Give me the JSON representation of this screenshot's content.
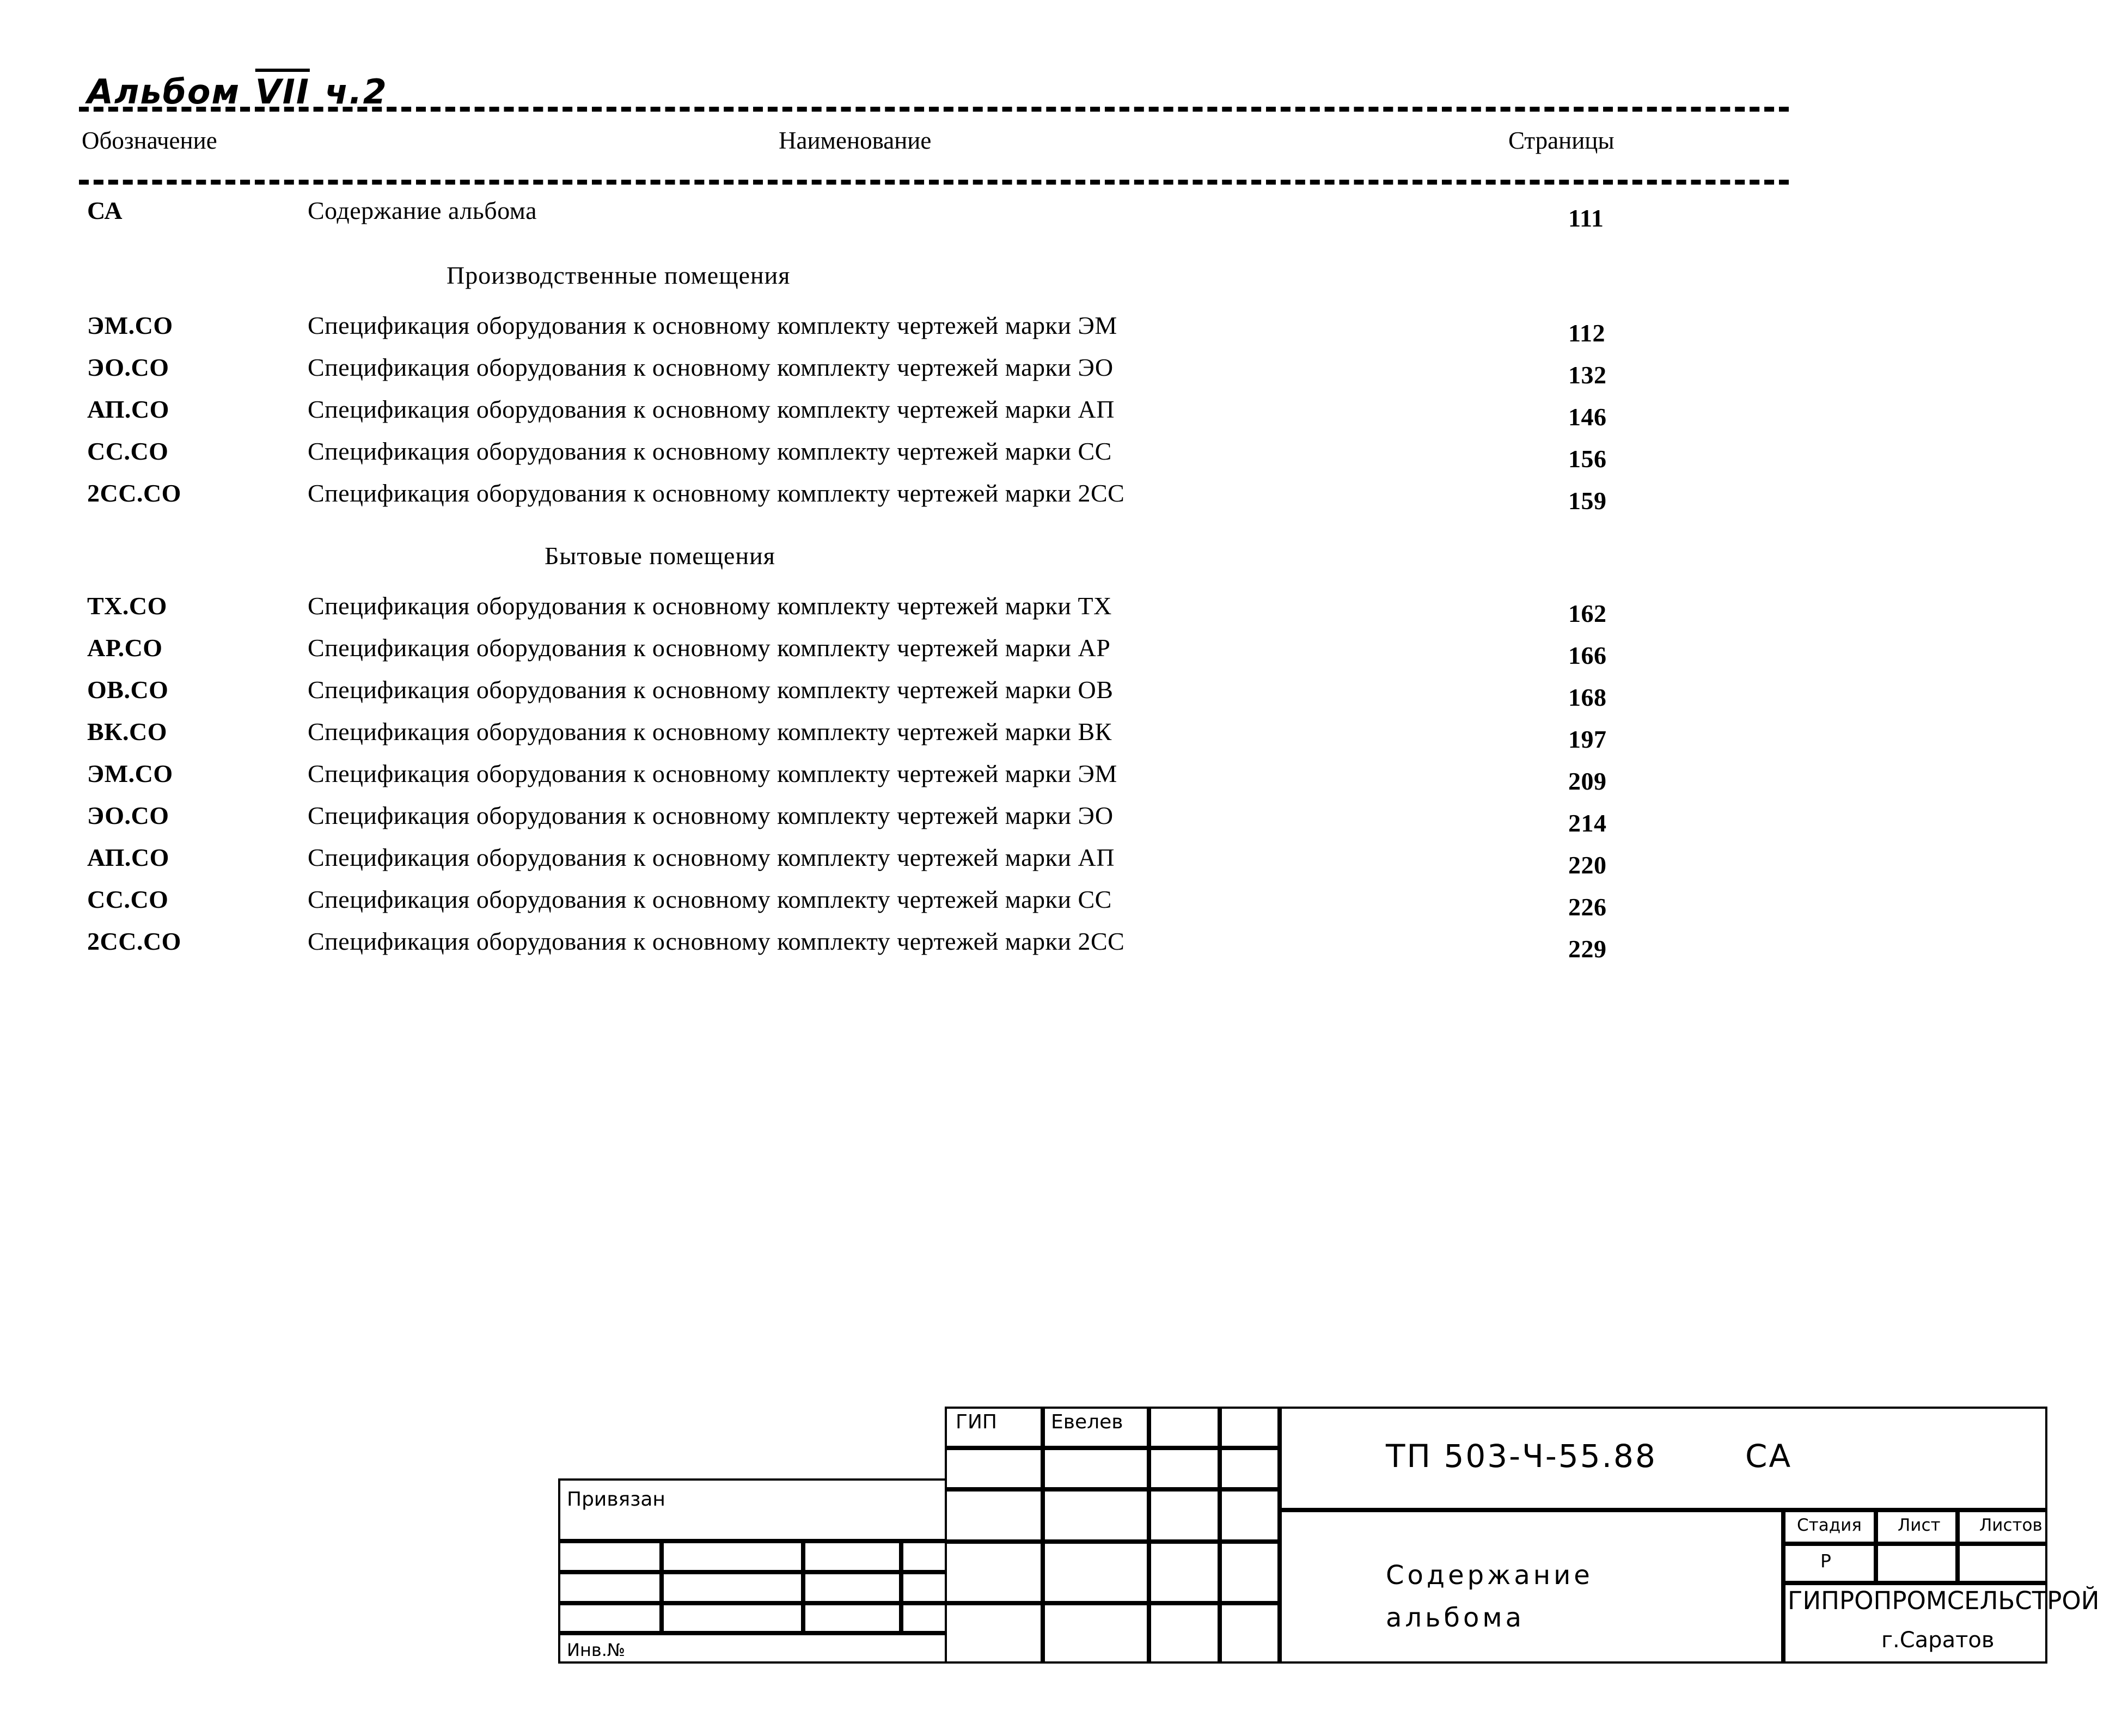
{
  "album_header": {
    "prefix": "Альбом",
    "roman": "VII",
    "part": "ч.2"
  },
  "columns": {
    "designation": "Обозначение",
    "name": "Наименование",
    "pages": "Страницы"
  },
  "rows": [
    {
      "code": "СА",
      "title": "Содержание альбома",
      "page": "111"
    }
  ],
  "sections": [
    {
      "heading": "Производственные помещения",
      "rows": [
        {
          "code": "ЭМ.СО",
          "title": "Спецификация оборудования к основному комплекту чертежей марки ЭМ",
          "page": "112"
        },
        {
          "code": "ЭО.СО",
          "title": "Спецификация оборудования к основному комплекту чертежей марки ЭО",
          "page": "132"
        },
        {
          "code": "АП.СО",
          "title": "Спецификация оборудования к основному комплекту чертежей марки АП",
          "page": "146"
        },
        {
          "code": "СС.СО",
          "title": "Спецификация оборудования к основному комплекту чертежей марки СС",
          "page": "156"
        },
        {
          "code": "2СС.СО",
          "title": "Спецификация оборудования к основному комплекту чертежей марки 2СС",
          "page": "159"
        }
      ]
    },
    {
      "heading": "Бытовые помещения",
      "rows": [
        {
          "code": "ТХ.СО",
          "title": "Спецификация оборудования к основному комплекту чертежей марки ТХ",
          "page": "162"
        },
        {
          "code": "АР.СО",
          "title": "Спецификация оборудования к основному комплекту чертежей марки АР",
          "page": "166"
        },
        {
          "code": "ОВ.СО",
          "title": "Спецификация оборудования к основному комплекту чертежей марки ОВ",
          "page": "168"
        },
        {
          "code": "ВК.СО",
          "title": "Спецификация оборудования к основному комплекту чертежей марки ВК",
          "page": "197"
        },
        {
          "code": "ЭМ.СО",
          "title": "Спецификация оборудования к основному комплекту чертежей марки ЭМ",
          "page": "209"
        },
        {
          "code": "ЭО.СО",
          "title": "Спецификация оборудования к основному комплекту чертежей марки ЭО",
          "page": "214"
        },
        {
          "code": "АП.СО",
          "title": "Спецификация оборудования к основному комплекту чертежей марки АП",
          "page": "220"
        },
        {
          "code": "СС.СО",
          "title": "Спецификация оборудования к основному комплекту чертежей марки СС",
          "page": "226"
        },
        {
          "code": "2СС.СО",
          "title": "Спецификация оборудования к основному комплекту чертежей марки 2СС",
          "page": "229"
        }
      ]
    }
  ],
  "title_block": {
    "privyazan_label": "Привязан",
    "inv_label": "Инв.№",
    "gip_label": "ГИП",
    "gip_name": "Евелев",
    "drawing_code": "ТП 503-Ч-55.88",
    "drawing_mark": "СА",
    "doc_name_line1": "Содержание",
    "doc_name_line2": "альбома",
    "stage_header": "Стадия",
    "sheet_header": "Лист",
    "sheets_header": "Листов",
    "stage_value": "Р",
    "sheet_value": "",
    "sheets_value": "",
    "organization": "ГИПРОПРОМСЕЛЬСТРОЙ",
    "city": "г.Саратов"
  }
}
